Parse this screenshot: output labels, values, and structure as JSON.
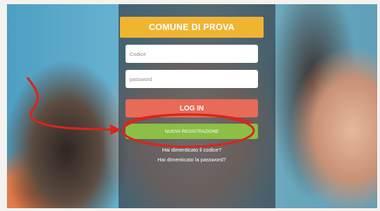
{
  "header": {
    "title": "COMUNE DI PROVA"
  },
  "form": {
    "codice_placeholder": "Codice",
    "password_placeholder": "password",
    "login_label": "LOG IN",
    "new_registration_label": "NUOVA REGISTRAZIONE",
    "link_1": "Hai dimenticato il codice?",
    "link_2": "Hai dimenticato la password?"
  },
  "colors": {
    "header": "#f0b433",
    "login_button": "#e86a58",
    "new_registration_button": "#8cbf45",
    "annotation": "#d9251c"
  }
}
